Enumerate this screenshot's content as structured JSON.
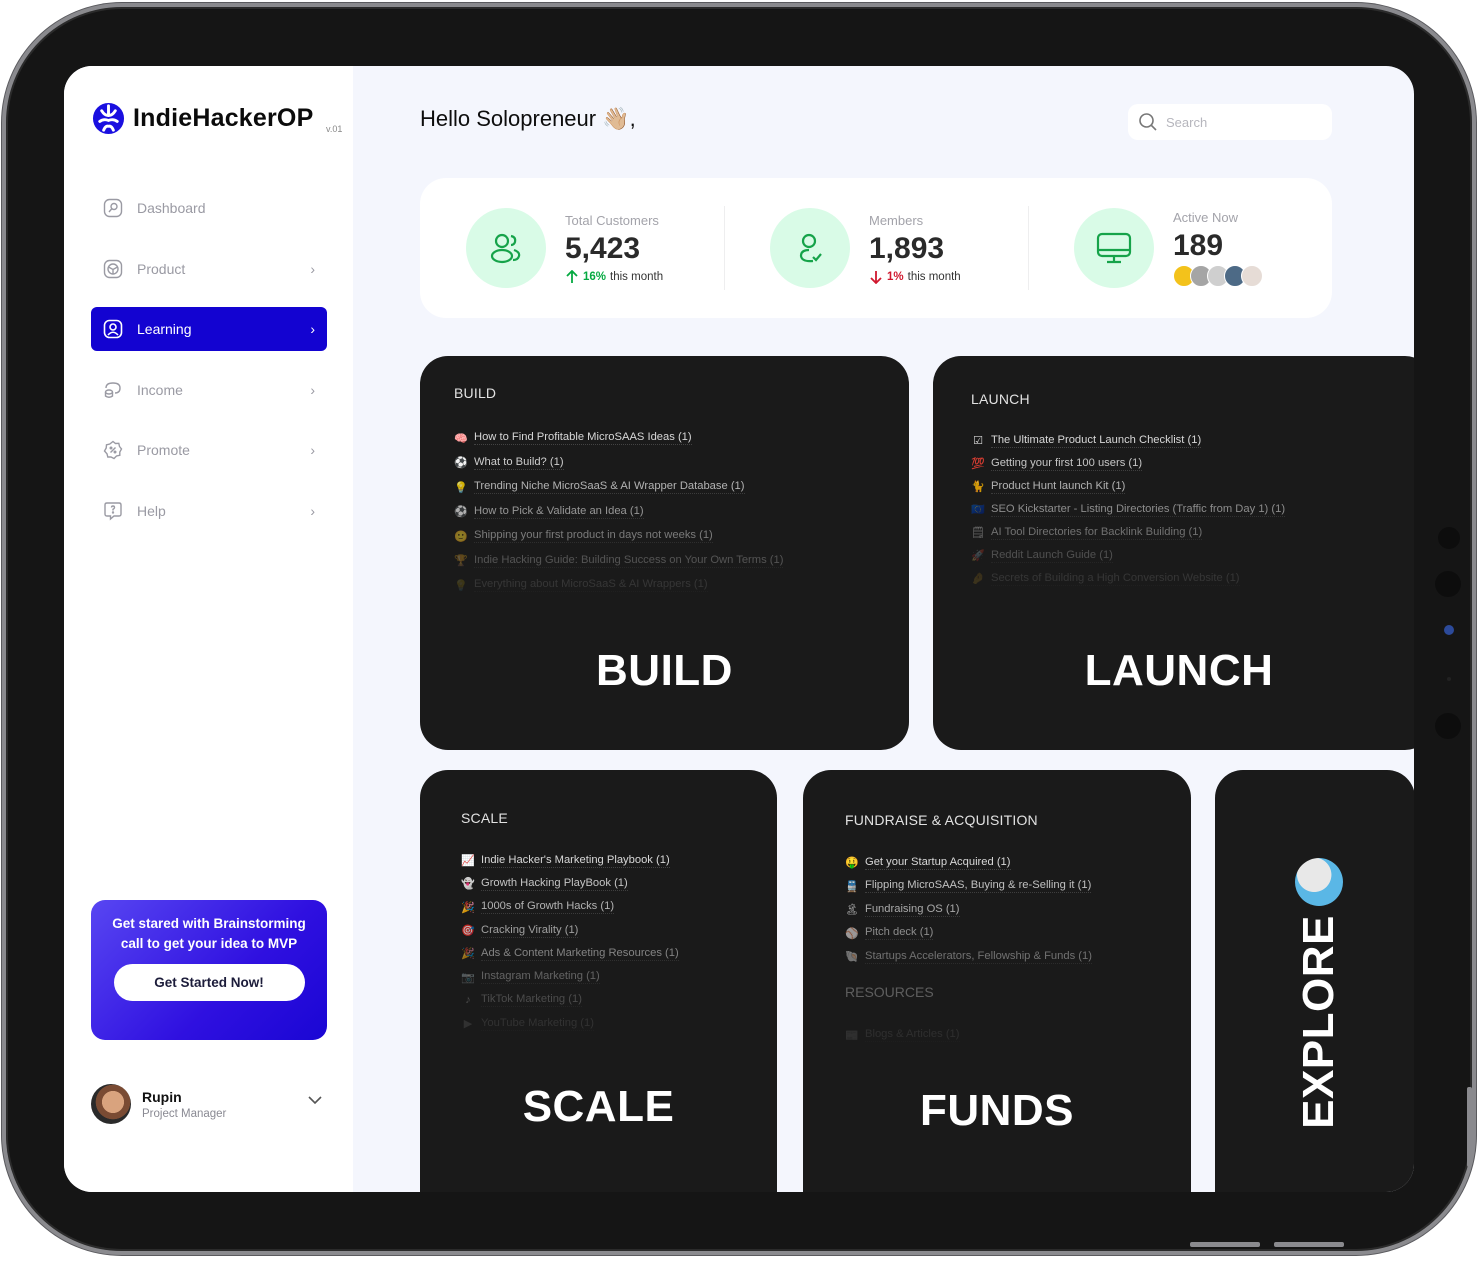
{
  "app": {
    "name": "IndieHackerOP",
    "version": "v.01",
    "brand_color": "#1303d1"
  },
  "sidebar": {
    "items": [
      {
        "label": "Dashboard",
        "icon": "dashboard-icon",
        "has_chevron": false,
        "active": false
      },
      {
        "label": "Product",
        "icon": "product-cube-icon",
        "has_chevron": true,
        "active": false
      },
      {
        "label": "Learning",
        "icon": "learning-user-icon",
        "has_chevron": true,
        "active": true
      },
      {
        "label": "Income",
        "icon": "income-wallet-icon",
        "has_chevron": true,
        "active": false
      },
      {
        "label": "Promote",
        "icon": "promote-discount-icon",
        "has_chevron": true,
        "active": false
      },
      {
        "label": "Help",
        "icon": "help-question-icon",
        "has_chevron": true,
        "active": false
      }
    ],
    "chevron": "›",
    "cta": {
      "text": "Get stared with Brainstorming call to get your idea to MVP",
      "button": "Get Started Now!"
    },
    "profile": {
      "name": "Rupin",
      "role": "Project Manager"
    }
  },
  "header": {
    "greeting": "Hello Solopreneur 👋🏼,",
    "search_placeholder": "Search"
  },
  "stats": [
    {
      "label": "Total Customers",
      "value": "5,423",
      "trend_dir": "up",
      "trend_pct": "16%",
      "trend_text": "this month",
      "icon": "users-icon"
    },
    {
      "label": "Members",
      "value": "1,893",
      "trend_dir": "down",
      "trend_pct": "1%",
      "trend_text": "this month",
      "icon": "user-check-icon"
    },
    {
      "label": "Active Now",
      "value": "189",
      "icon": "monitor-icon",
      "avatar_count": 5
    }
  ],
  "trend_colors": {
    "up": "#05a941",
    "down": "#d0182f"
  },
  "cards": {
    "build": {
      "heading": "BUILD",
      "big_label": "BUILD",
      "items": [
        {
          "emoji": "🧠",
          "text": "How to Find Profitable MicroSAAS Ideas (1)"
        },
        {
          "emoji": "⚽",
          "text": "What to Build? (1)"
        },
        {
          "emoji": "💡",
          "text": "Trending Niche MicroSaaS & AI Wrapper Database (1)"
        },
        {
          "emoji": "⚽",
          "text": "How to Pick & Validate an Idea (1)"
        },
        {
          "emoji": "🙂",
          "text": "Shipping your first product in days not weeks (1)"
        },
        {
          "emoji": "🏆",
          "text": "Indie Hacking Guide: Building Success on Your Own Terms (1)"
        },
        {
          "emoji": "💡",
          "text": "Everything about MicroSaaS & AI Wrappers (1)"
        }
      ]
    },
    "launch": {
      "heading": "LAUNCH",
      "big_label": "LAUNCH",
      "items": [
        {
          "emoji": "☑",
          "text": "The Ultimate Product Launch Checklist (1)"
        },
        {
          "emoji": "💯",
          "text": "Getting your first 100 users (1)"
        },
        {
          "emoji": "🐈",
          "text": "Product Hunt launch Kit (1)"
        },
        {
          "emoji": "🇪🇺",
          "text": "SEO Kickstarter - Listing Directories (Traffic from Day 1) (1)"
        },
        {
          "emoji": "🗒",
          "text": "AI Tool Directories for Backlink Building (1)"
        },
        {
          "emoji": "🚀",
          "text": "Reddit Launch Guide (1)"
        },
        {
          "emoji": "🤌",
          "text": "Secrets of Building a High Conversion Website (1)"
        }
      ]
    },
    "scale": {
      "heading": "SCALE",
      "big_label": "SCALE",
      "items": [
        {
          "emoji": "📈",
          "text": "Indie Hacker's Marketing Playbook (1)"
        },
        {
          "emoji": "👻",
          "text": "Growth Hacking PlayBook (1)"
        },
        {
          "emoji": "🎉",
          "text": "1000s of Growth Hacks (1)"
        },
        {
          "emoji": "🎯",
          "text": "Cracking Virality (1)"
        },
        {
          "emoji": "🎉",
          "text": "Ads & Content Marketing Resources (1)"
        },
        {
          "emoji": "📷",
          "text": "Instagram Marketing (1)"
        },
        {
          "emoji": "♪",
          "text": "TikTok Marketing (1)"
        },
        {
          "emoji": "▶",
          "text": "YouTube Marketing (1)"
        }
      ]
    },
    "funds": {
      "heading": "FUNDRAISE & ACQUISITION",
      "big_label": "FUNDS",
      "items": [
        {
          "emoji": "🤑",
          "text": "Get your Startup Acquired (1)"
        },
        {
          "emoji": "🚆",
          "text": "Flipping MicroSAAS, Buying & re-Selling it (1)"
        },
        {
          "emoji": "🏝",
          "text": "Fundraising OS (1)"
        },
        {
          "emoji": "⚾",
          "text": "Pitch deck (1)"
        },
        {
          "emoji": "🐚",
          "text": "Startups Accelerators, Fellowship & Funds (1)"
        }
      ],
      "sub_heading": "RESOURCES",
      "sub_items": [
        {
          "emoji": "📰",
          "text": "Blogs & Articles (1)"
        }
      ]
    },
    "explore": {
      "big_label": "EXPLORE",
      "emoji": "🌐"
    }
  }
}
